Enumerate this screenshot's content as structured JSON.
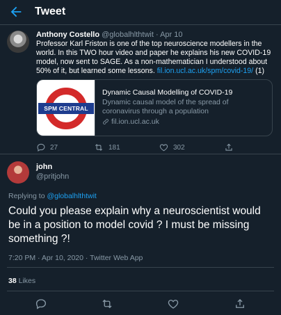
{
  "header": {
    "title": "Tweet"
  },
  "quoted_tweet": {
    "author_name": "Anthony Costello",
    "author_handle": "@globalhlthtwit",
    "separator": "·",
    "date": "Apr 10",
    "text": "Professor Karl Friston is one of the top neuroscience modellers in the world. In this TWO hour video and paper he explains his new COVID-19 model, now sent to SAGE. As a non-mathematician I understood about 50% of it, but learned some lessons.",
    "link_text": "fil.ion.ucl.ac.uk/spm/covid-19/",
    "link_suffix": "(1)",
    "card": {
      "image_label": "SPM CENTRAL",
      "title": "Dynamic Causal Modelling of COVID-19",
      "description": "Dynamic causal model of the spread of coronavirus through a population",
      "url": "fil.ion.ucl.ac.uk"
    },
    "reply_count": "",
    "retweet_count": "181",
    "like_count": "302",
    "comment_count": "27"
  },
  "reply_tweet": {
    "author_name": "john",
    "author_handle": "@pritjohn",
    "replying_prefix": "Replying to",
    "replying_handle": "@globalhlthtwit",
    "text": "Could you please explain why a neuroscientist would be in a position to model covid ? I must be missing something ?!",
    "meta": "7:20 PM · Apr 10, 2020 · Twitter Web App",
    "likes_count": "38",
    "likes_label": "Likes"
  },
  "colors": {
    "background": "#15202b",
    "accent": "#1da1f2",
    "muted": "#8899a6",
    "border": "#38444d"
  }
}
